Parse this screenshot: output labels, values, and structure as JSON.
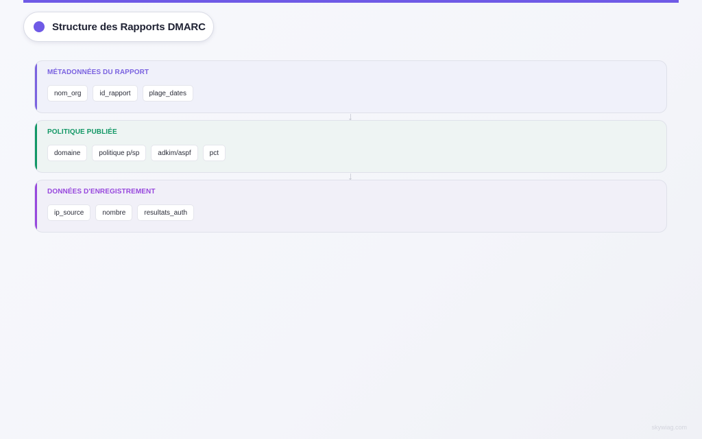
{
  "title": "Structure des Rapports DMARC",
  "colors": {
    "accent": "#6f5ae6",
    "layer1": "#7a62e0",
    "layer2": "#119765",
    "layer3": "#9747dd"
  },
  "layers": [
    {
      "title": "Métadonnées du Rapport",
      "chips": [
        "nom_org",
        "id_rapport",
        "plage_dates"
      ]
    },
    {
      "title": "Politique Publiée",
      "chips": [
        "domaine",
        "politique p/sp",
        "adkim/aspf",
        "pct"
      ]
    },
    {
      "title": "Données d'Enregistrement",
      "chips": [
        "ip_source",
        "nombre",
        "resultats_auth"
      ]
    }
  ],
  "watermark": "skywiag.com"
}
